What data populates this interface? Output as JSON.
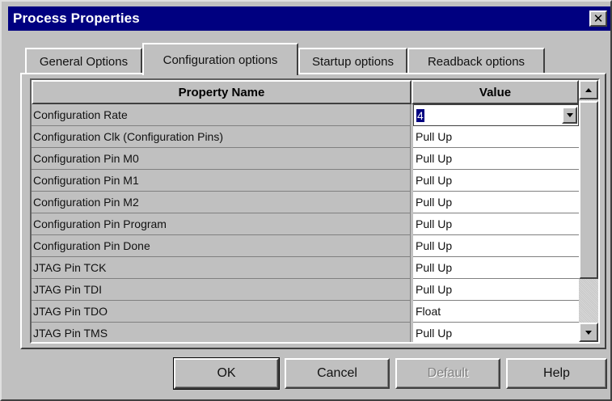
{
  "window": {
    "title": "Process Properties",
    "close_glyph": "✕"
  },
  "tabs": [
    {
      "label": "General Options",
      "active": false
    },
    {
      "label": "Configuration options",
      "active": true
    },
    {
      "label": "Startup options",
      "active": false
    },
    {
      "label": "Readback options",
      "active": false
    }
  ],
  "grid": {
    "columns": [
      "Property Name",
      "Value"
    ],
    "rows": [
      {
        "name": "Configuration Rate",
        "value": "4"
      },
      {
        "name": "Configuration Clk (Configuration Pins)",
        "value": "Pull Up"
      },
      {
        "name": "Configuration Pin M0",
        "value": "Pull Up"
      },
      {
        "name": "Configuration Pin M1",
        "value": "Pull Up"
      },
      {
        "name": "Configuration Pin M2",
        "value": "Pull Up"
      },
      {
        "name": "Configuration Pin Program",
        "value": "Pull Up"
      },
      {
        "name": "Configuration Pin Done",
        "value": "Pull Up"
      },
      {
        "name": "JTAG Pin TCK",
        "value": "Pull Up"
      },
      {
        "name": "JTAG Pin TDI",
        "value": "Pull Up"
      },
      {
        "name": "JTAG Pin TDO",
        "value": "Float"
      },
      {
        "name": "JTAG Pin TMS",
        "value": "Pull Up"
      }
    ]
  },
  "buttons": {
    "ok": "OK",
    "cancel": "Cancel",
    "default": "Default",
    "help": "Help"
  },
  "icons": {
    "close": "close-icon",
    "dropdown": "chevron-down-icon",
    "scroll_up": "scroll-up-icon",
    "scroll_down": "scroll-down-icon"
  },
  "colors": {
    "titlebar": "#000080",
    "face": "#c0c0c0",
    "selection": "#000080"
  }
}
